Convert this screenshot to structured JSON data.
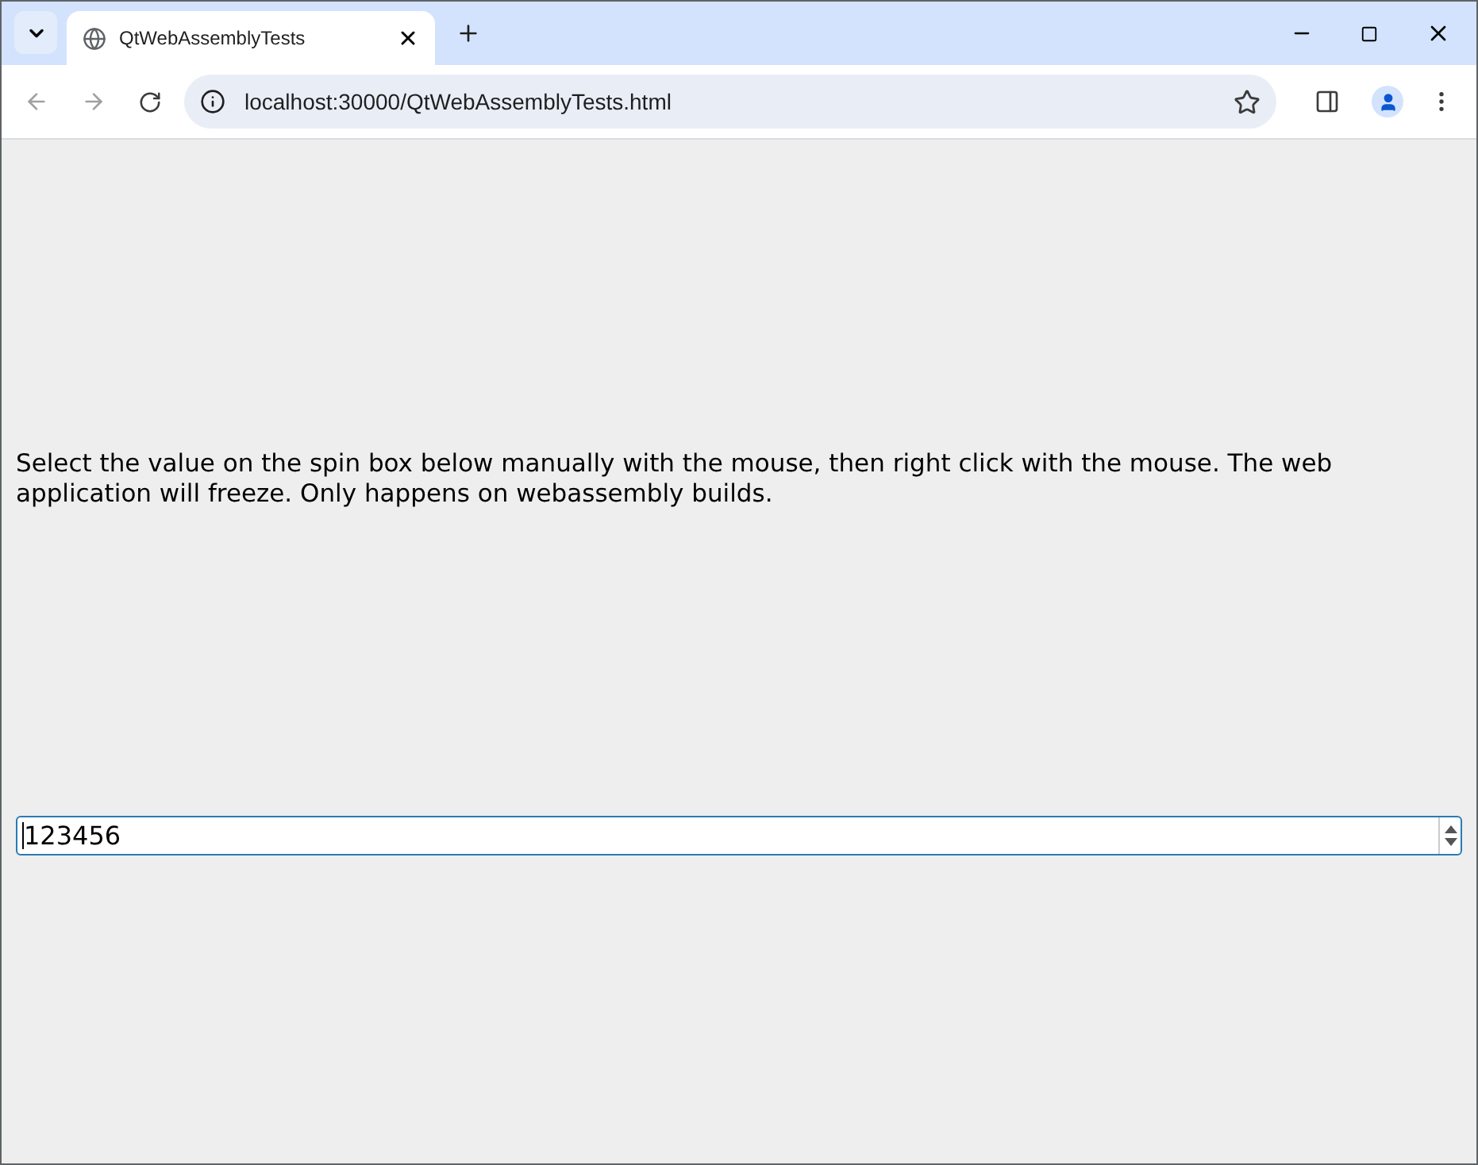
{
  "browser": {
    "tab_title": "QtWebAssemblyTests",
    "address": "localhost:30000/QtWebAssemblyTests.html"
  },
  "page": {
    "instructions": "Select the value on the spin box below manually with the mouse, then right click with the mouse. The web application will freeze. Only happens on webassembly builds.",
    "spin_box": {
      "value": "123456"
    }
  }
}
